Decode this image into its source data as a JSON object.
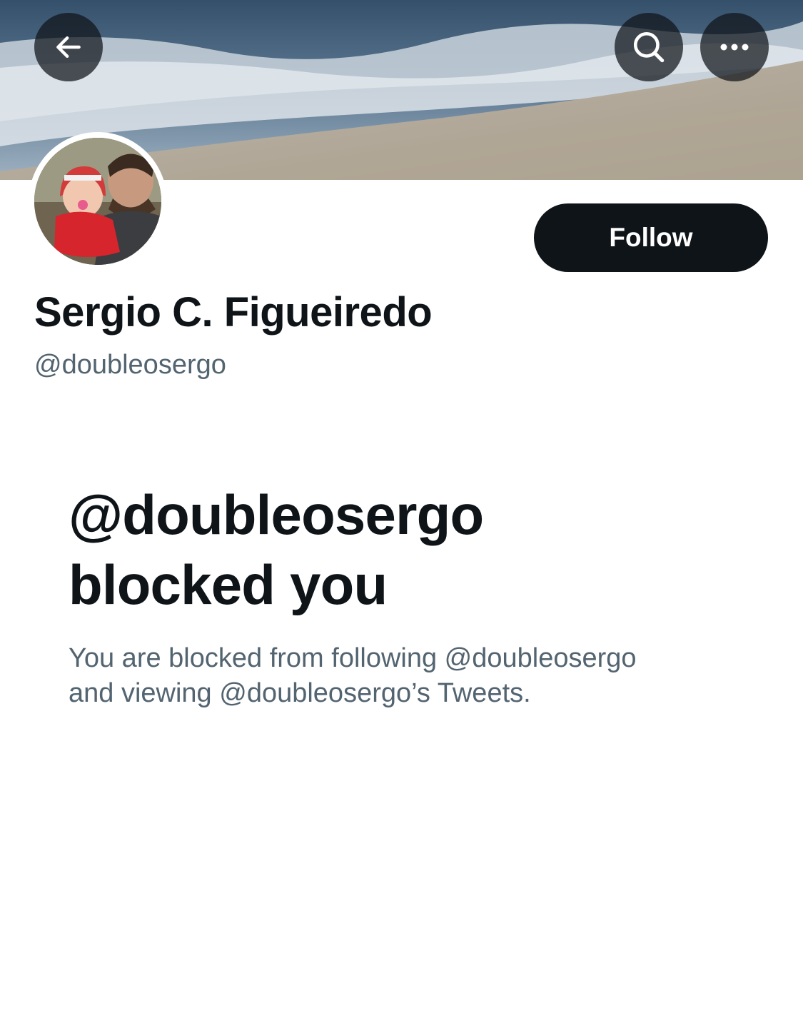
{
  "header": {
    "back_icon": "arrow-left-icon",
    "search_icon": "search-icon",
    "more_icon": "more-horizontal-icon"
  },
  "profile": {
    "display_name": "Sergio C. Figueiredo",
    "handle": "@doubleosergo",
    "follow_label": "Follow"
  },
  "blocked": {
    "title_line1": "@doubleosergo",
    "title_line2": "blocked you",
    "description_line1": "You are blocked from following @doubleosergo",
    "description_line2": "and viewing @doubleosergo’s Tweets."
  },
  "colors": {
    "text_primary": "#0f1419",
    "text_secondary": "#536471",
    "button_bg": "#0f1419",
    "button_text": "#ffffff"
  }
}
